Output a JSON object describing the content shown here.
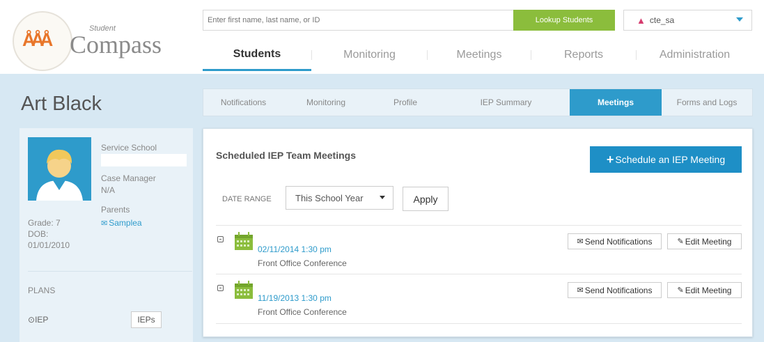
{
  "header": {
    "logo_small": "Student",
    "logo_big": "Compass",
    "search_placeholder": "Enter first name, last name, or ID",
    "lookup_label": "Lookup Students",
    "user_name": "cte_sa"
  },
  "main_nav": [
    {
      "label": "Students",
      "active": true
    },
    {
      "label": "Monitoring",
      "active": false
    },
    {
      "label": "Meetings",
      "active": false
    },
    {
      "label": "Reports",
      "active": false
    },
    {
      "label": "Administration",
      "active": false
    }
  ],
  "student": {
    "name": "Art Black",
    "service_school_label": "Service School",
    "case_manager_label": "Case Manager",
    "case_manager_value": "N/A",
    "parents_label": "Parents",
    "parent_name": "Samplea",
    "grade_label": "Grade: 7",
    "dob_label": "DOB:",
    "dob_value": "01/01/2010",
    "plans_label": "PLANS",
    "plan_name": "IEP",
    "plan_button": "IEPs"
  },
  "sub_tabs": [
    {
      "label": "Notifications",
      "active": false
    },
    {
      "label": "Monitoring",
      "active": false
    },
    {
      "label": "Profile",
      "active": false
    },
    {
      "label": "IEP Summary",
      "active": false
    },
    {
      "label": "Meetings",
      "active": true
    },
    {
      "label": "Forms and Logs",
      "active": false
    }
  ],
  "panel": {
    "title": "Scheduled IEP Team Meetings",
    "schedule_button": "Schedule an IEP Meeting",
    "date_range_label": "DATE RANGE",
    "date_range_value": "This School Year",
    "apply_label": "Apply",
    "meetings": [
      {
        "date": "02/11/2014 1:30 pm",
        "location": "Front Office Conference",
        "notify_label": "Send Notifications",
        "edit_label": "Edit Meeting"
      },
      {
        "date": "11/19/2013 1:30 pm",
        "location": "Front Office Conference",
        "notify_label": "Send Notifications",
        "edit_label": "Edit Meeting"
      }
    ]
  },
  "colors": {
    "accent": "#2e9bcb",
    "lookup_green": "#8bbd3c",
    "sidebar_bg": "#d7e8f3",
    "calendar_green": "#8bbd3c"
  }
}
